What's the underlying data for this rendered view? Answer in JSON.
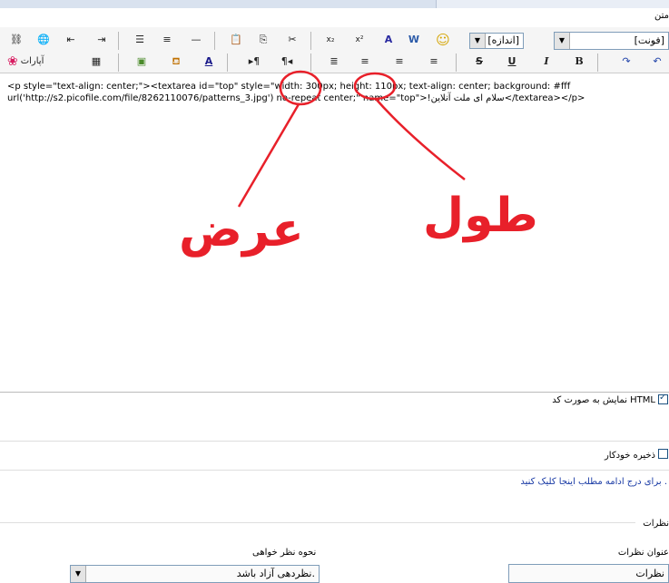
{
  "header": {
    "editor_label": "متن"
  },
  "toolbar": {
    "font_combo": "[فونت]",
    "size_combo": "[اندازه]",
    "aparat_label": "آپارات",
    "bold": "B",
    "italic": "I",
    "underline": "U",
    "strike": "S",
    "superscript": "x²",
    "subscript": "x₂"
  },
  "editor": {
    "code_line1": "<p style=\"text-align: center;\"><textarea id=\"top\" style=\"width: 300px; height: 110px; text-align: center; background: #fff",
    "code_line2": "url('http://s2.picofile.com/file/8262110076/patterns_3.jpg') no-repeat center;\" name=\"top\">!سلام ای ملت آنلاین</textarea></p>"
  },
  "annotations": {
    "width_label": "عرض",
    "height_label": "طول",
    "color": "#e8202a"
  },
  "options": {
    "show_html_label": "نمایش به صورت کد HTML",
    "show_html_checked": true,
    "autosave_label": "ذخیره خودکار",
    "autosave_checked": false,
    "read_more_link": "برای درج ادامه مطلب اینجا کلیک کنید ."
  },
  "comments": {
    "section_title": "نظرات",
    "title_label": "عنوان نظرات",
    "title_value": "نظرات",
    "mode_label": "نحوه نظر خواهی",
    "mode_value": "نظردهی آزاد باشد."
  }
}
